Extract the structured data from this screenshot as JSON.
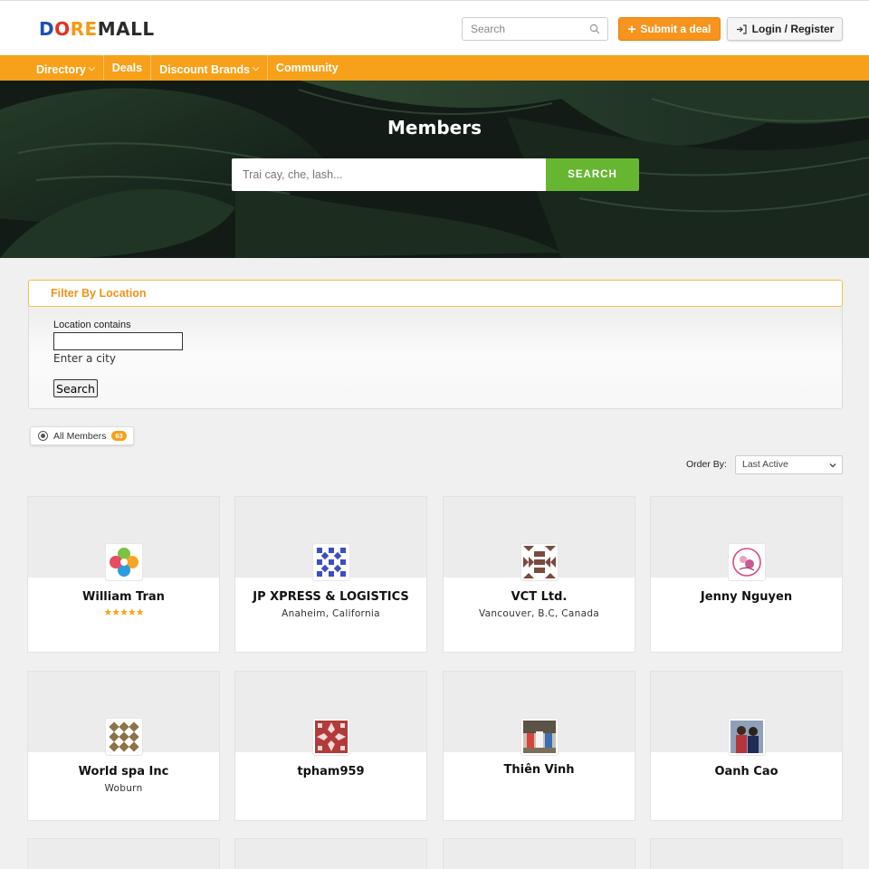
{
  "brand": {
    "logo_parts": [
      "D",
      "O",
      "RE",
      "MALL"
    ]
  },
  "header": {
    "search_placeholder": "Search",
    "submit_label": "Submit a deal",
    "login_label": "Login / Register"
  },
  "nav": {
    "items": [
      "Directory",
      "Deals",
      "Discount Brands",
      "Community"
    ]
  },
  "hero": {
    "title": "Members",
    "search_placeholder": "Trai cay, che, lash...",
    "search_button": "SEARCH"
  },
  "filter": {
    "title": "Filter By Location",
    "label": "Location contains",
    "hint": "Enter a city",
    "button": "Search"
  },
  "tabs": {
    "all_label": "All Members",
    "all_count": "63"
  },
  "order": {
    "label": "Order By:",
    "selected": "Last Active"
  },
  "members": [
    {
      "name": "William Tran",
      "location": "",
      "stars": "★★★★★"
    },
    {
      "name": "JP XPRESS & LOGISTICS",
      "location": "Anaheim, California"
    },
    {
      "name": "VCT Ltd.",
      "location": "Vancouver, B.C, Canada"
    },
    {
      "name": "Jenny Nguyen",
      "location": ""
    },
    {
      "name": "World spa Inc",
      "location": "Woburn"
    },
    {
      "name": "tpham959",
      "location": ""
    },
    {
      "name": "Thiên Vinh",
      "location": ""
    },
    {
      "name": "Oanh Cao",
      "location": ""
    }
  ],
  "colors": {
    "accent": "#f7a11a",
    "green": "#67b631",
    "brand_blue": "#1d4fb3"
  }
}
